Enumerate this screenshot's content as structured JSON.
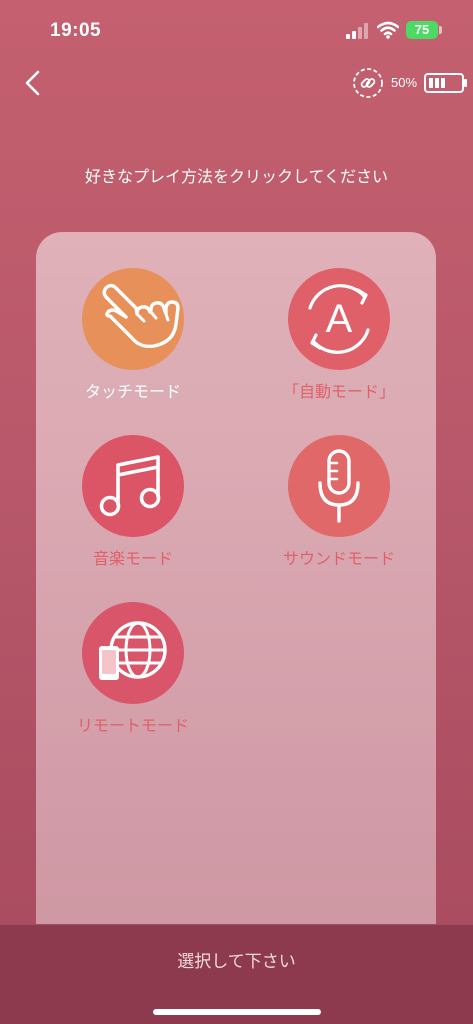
{
  "status_bar": {
    "time": "19:05",
    "battery_level": "75"
  },
  "header": {
    "back_icon": "chevron-left-icon",
    "link_icon": "link-icon",
    "device_battery": "50%"
  },
  "instruction": "好きなプレイ方法をクリックしてください",
  "modes": [
    {
      "label": "タッチモード",
      "icon": "hand-pointer-icon",
      "circle_color": "#e8905a",
      "label_color": "#ffffff"
    },
    {
      "label": "「自動モード」",
      "icon": "auto-a-icon",
      "circle_color": "#e0606a",
      "label_color": "#e0606a"
    },
    {
      "label": "音楽モード",
      "icon": "music-note-icon",
      "circle_color": "#dc5566",
      "label_color": "#e0606a"
    },
    {
      "label": "サウンドモード",
      "icon": "microphone-icon",
      "circle_color": "#e06868",
      "label_color": "#e0606a"
    },
    {
      "label": "リモートモード",
      "icon": "globe-phone-icon",
      "circle_color": "#d9556a",
      "label_color": "#e0606a"
    }
  ],
  "footer": {
    "select_label": "選択して下さい"
  }
}
